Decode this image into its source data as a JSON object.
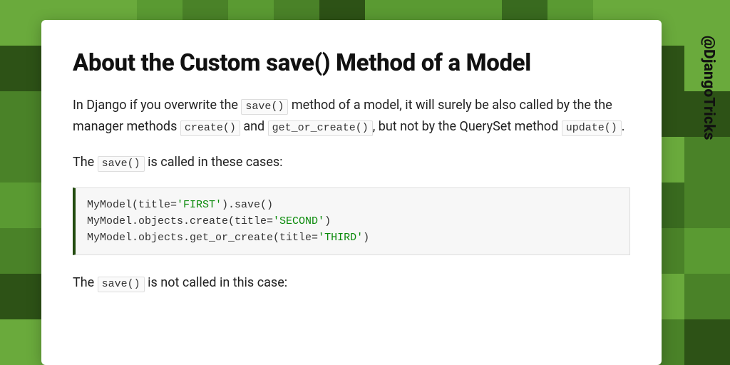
{
  "handle": "@DjangoTricks",
  "title": "About the Custom save() Method of a Model",
  "p1": {
    "t1": "In Django if you overwrite the ",
    "c1": "save()",
    "t2": " method of a model, it will surely be also called by the the manager methods ",
    "c2": "create()",
    "t3": " and ",
    "c3": "get_or_create()",
    "t4": ", but not by the QuerySet method ",
    "c4": "update()",
    "t5": "."
  },
  "p2": {
    "t1": "The ",
    "c1": "save()",
    "t2": " is called in these cases:"
  },
  "code": {
    "l1a": "MyModel(title=",
    "l1s": "'FIRST'",
    "l1b": ").save()",
    "l2a": "MyModel.objects.create(title=",
    "l2s": "'SECOND'",
    "l2b": ")",
    "l3a": "MyModel.objects.get_or_create(title=",
    "l3s": "'THIRD'",
    "l3b": ")"
  },
  "p3": {
    "t1": "The ",
    "c1": "save()",
    "t2": " is not called in this case:"
  }
}
